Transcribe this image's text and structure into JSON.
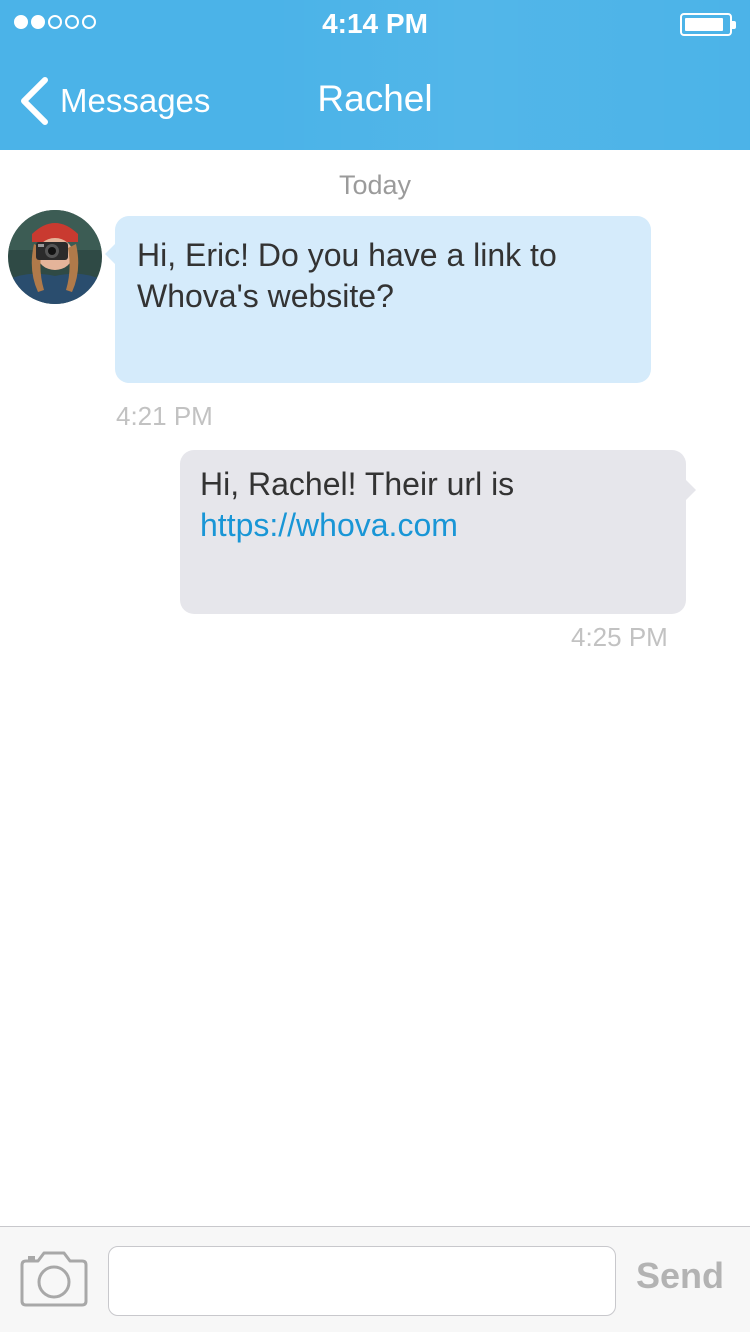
{
  "status_bar": {
    "signal_bars": [
      true,
      true,
      false,
      false,
      false
    ],
    "time": "4:14 PM",
    "battery_level": 0.8
  },
  "nav": {
    "back_label": "Messages",
    "title": "Rachel",
    "color": "#4bb3e8"
  },
  "thread": {
    "day_separator": "Today",
    "messages": [
      {
        "direction": "incoming",
        "text_before_link": "Hi, Eric! Do you have a link to Whova's website?",
        "link": "",
        "time": "4:21 PM",
        "bubble_color": "#d5ebfb"
      },
      {
        "direction": "outgoing",
        "text_before_link": "Hi, Rachel! Their url is",
        "link": "https://whova.com",
        "time": "4:25 PM",
        "bubble_color": "#e6e6eb"
      }
    ]
  },
  "composer": {
    "camera_icon": "camera-icon",
    "input_value": "",
    "send_label": "Send"
  }
}
